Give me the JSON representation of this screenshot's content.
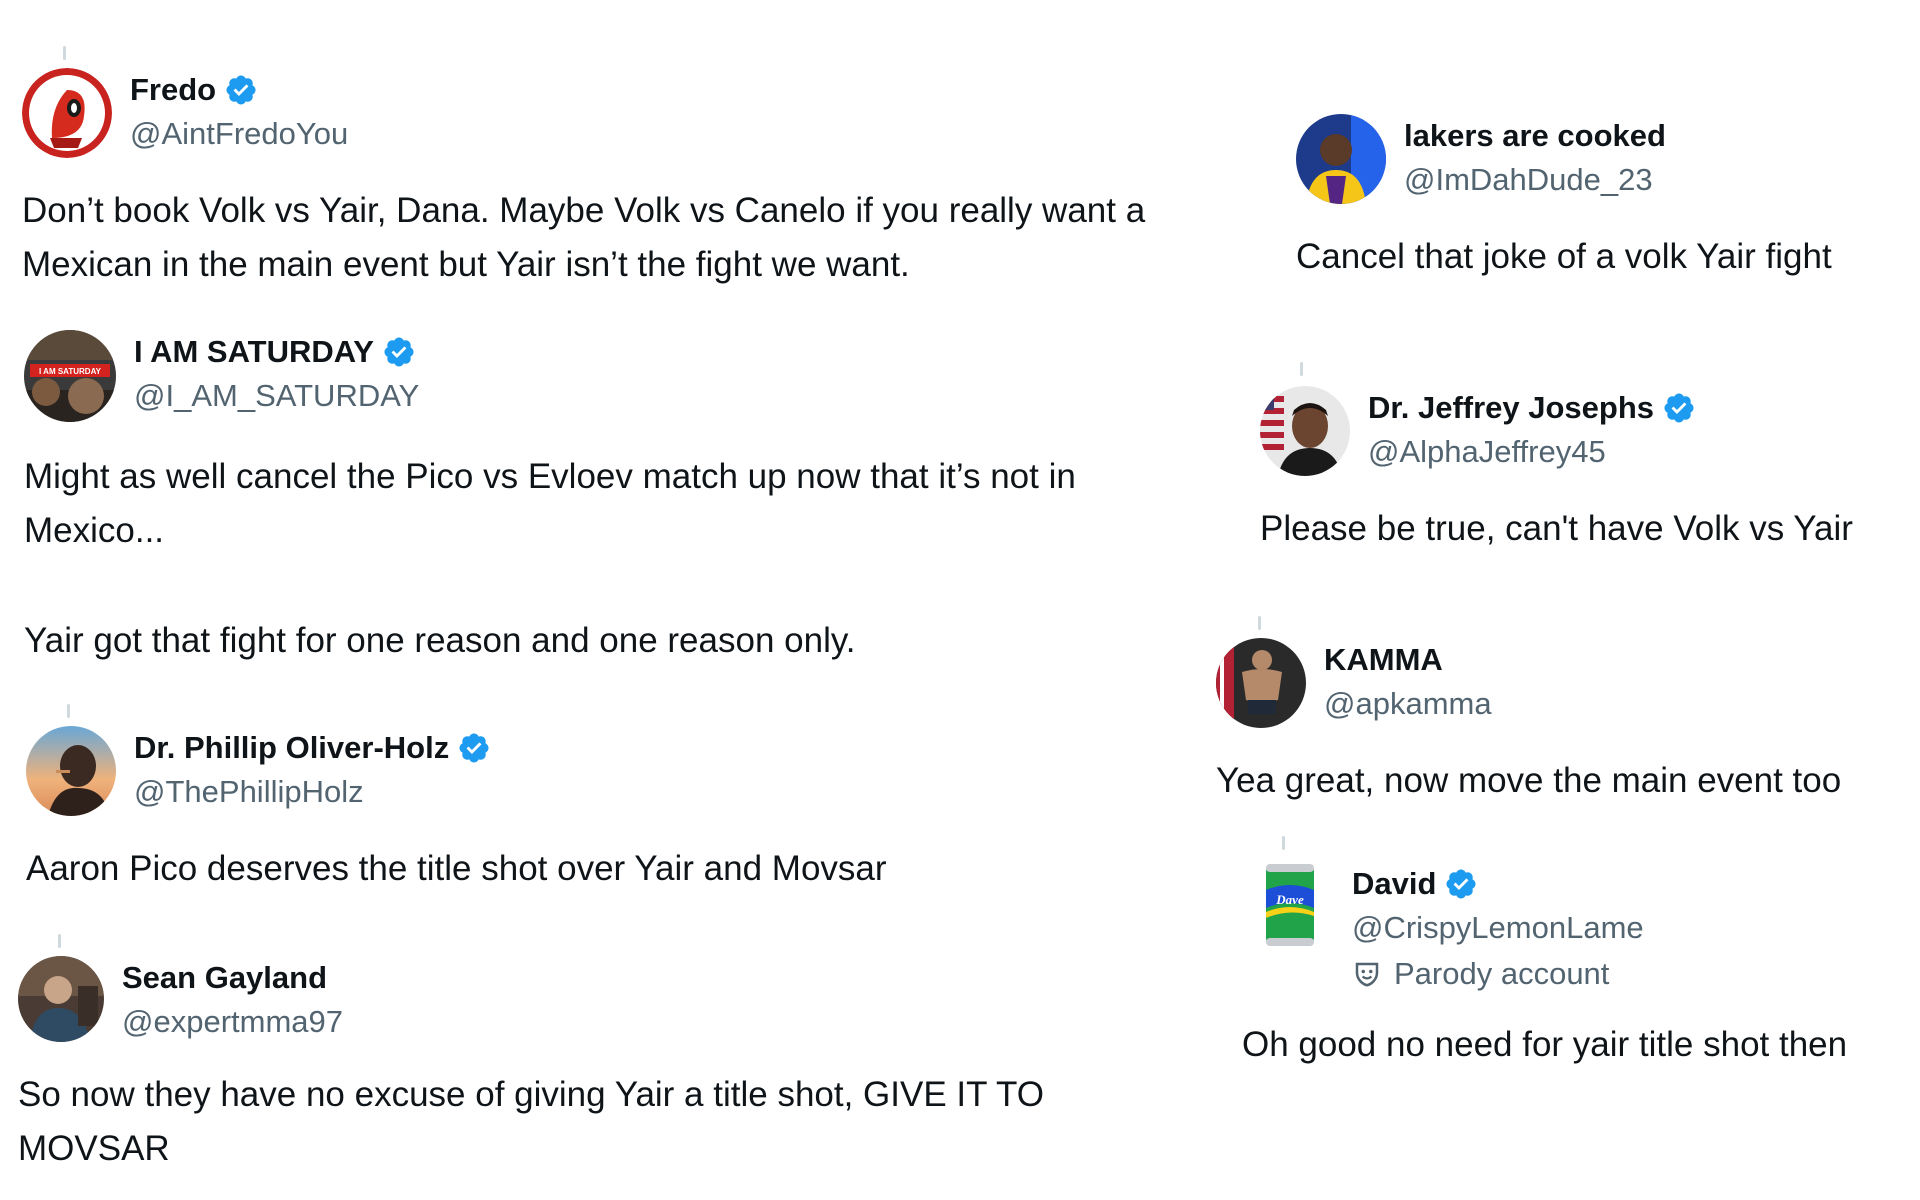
{
  "tweets": {
    "fredo": {
      "name": "Fredo",
      "handle": "@AintFredoYou",
      "verified": true,
      "avatar_icon": "deadpool-avatar",
      "text": [
        "Don’t book Volk vs Yair, Dana. Maybe Volk vs Canelo if you really want a",
        "Mexican in the main event but Yair isn’t the fight we want."
      ]
    },
    "saturday": {
      "name": "I AM SATURDAY",
      "handle": "@I_AM_SATURDAY",
      "verified": true,
      "avatar_icon": "saturday-avatar",
      "avatar_text": "I AM SATURDAY",
      "text": [
        "Might as well cancel the Pico vs Evloev match up now that it’s not in",
        "Mexico..."
      ],
      "text2": "Yair got that fight for one reason and one reason only."
    },
    "phillip": {
      "name": "Dr. Phillip Oliver-Holz",
      "handle": "@ThePhillipHolz",
      "verified": true,
      "avatar_icon": "man-sunset-avatar",
      "text": [
        "Aaron Pico deserves the title shot over Yair and Movsar"
      ]
    },
    "sean": {
      "name": "Sean Gayland",
      "handle": "@expertmma97",
      "verified": false,
      "avatar_icon": "man-outdoor-avatar",
      "text": [
        "So now they have no excuse of giving Yair a title shot, GIVE IT TO",
        "MOVSAR"
      ]
    },
    "lakers": {
      "name": "lakers are cooked",
      "handle": "@ImDahDude_23",
      "verified": false,
      "avatar_icon": "basketball-player-avatar",
      "text": [
        "Cancel that joke of a volk Yair fight"
      ]
    },
    "jeffrey": {
      "name": "Dr. Jeffrey Josephs",
      "handle": "@AlphaJeffrey45",
      "verified": true,
      "avatar_icon": "man-flag-avatar",
      "text": [
        "Please be true, can't have Volk vs Yair"
      ]
    },
    "kamma": {
      "name": "KAMMA",
      "handle": "@apkamma",
      "verified": false,
      "avatar_icon": "fighter-avatar",
      "text": [
        "Yea great, now move the main event too"
      ]
    },
    "david": {
      "name": "David",
      "handle": "@CrispyLemonLame",
      "verified": true,
      "avatar_icon": "soda-can-avatar",
      "avatar_text": "Dave",
      "parody_label": "Parody account",
      "parody_icon": "theater-mask-icon",
      "text": [
        "Oh good no need for yair title shot then"
      ]
    }
  },
  "colors": {
    "verified_blue": "#1d9bf0",
    "handle_gray": "#536471",
    "text": "#0f1419"
  }
}
